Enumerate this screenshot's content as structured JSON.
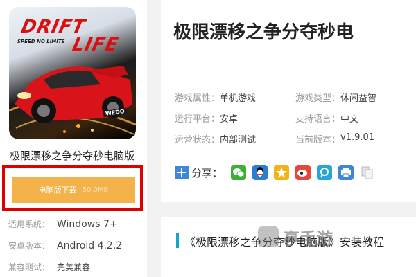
{
  "app": {
    "logo": {
      "line1": "DRIFT",
      "line2": "LIFE",
      "tagline": "SPEED NO LIMITS",
      "car_plate": "WEDO"
    },
    "name": "极限漂移之争分夺秒电脑版"
  },
  "download": {
    "label": "电脑版下载",
    "size": "50.0MB",
    "button_color": "#f3b34a",
    "highlight_color": "#e00000"
  },
  "left_info": [
    {
      "key": "适用系统：",
      "value": "Windows 7+"
    },
    {
      "key": "安卓版本：",
      "value": "Android 4.2.2"
    },
    {
      "key": "兼容测试：",
      "value": "完美兼容"
    }
  ],
  "title": "极限漂移之争分夺秒电",
  "attributes": [
    {
      "key": "游戏属性：",
      "value": "单机游戏"
    },
    {
      "key": "游戏类型：",
      "value": "休闲益智"
    },
    {
      "key": "运行平台：",
      "value": "安卓"
    },
    {
      "key": "支持语言：",
      "value": "中文"
    },
    {
      "key": "运营状态：",
      "value": "内部测试"
    },
    {
      "key": "当前版本：",
      "value": "v1.9.01"
    }
  ],
  "share": {
    "label": "分享：",
    "icons": [
      {
        "name": "wechat-icon",
        "color": "#3cb034"
      },
      {
        "name": "qq-icon",
        "color": "#2a7fd4"
      },
      {
        "name": "qzone-icon",
        "color": "#f2b316"
      },
      {
        "name": "weibo-icon",
        "color": "#e4483a"
      },
      {
        "name": "tencent-weibo-icon",
        "color": "#2aa5d8"
      },
      {
        "name": "print-icon",
        "color": "#3d86d8"
      },
      {
        "name": "copy-icon",
        "color": "#c8c8c8"
      }
    ]
  },
  "section": {
    "title": "《极限漂移之争分夺秒电脑版》安装教程",
    "accent_color": "#19a3c9"
  },
  "watermark": {
    "text": "亭手游"
  }
}
